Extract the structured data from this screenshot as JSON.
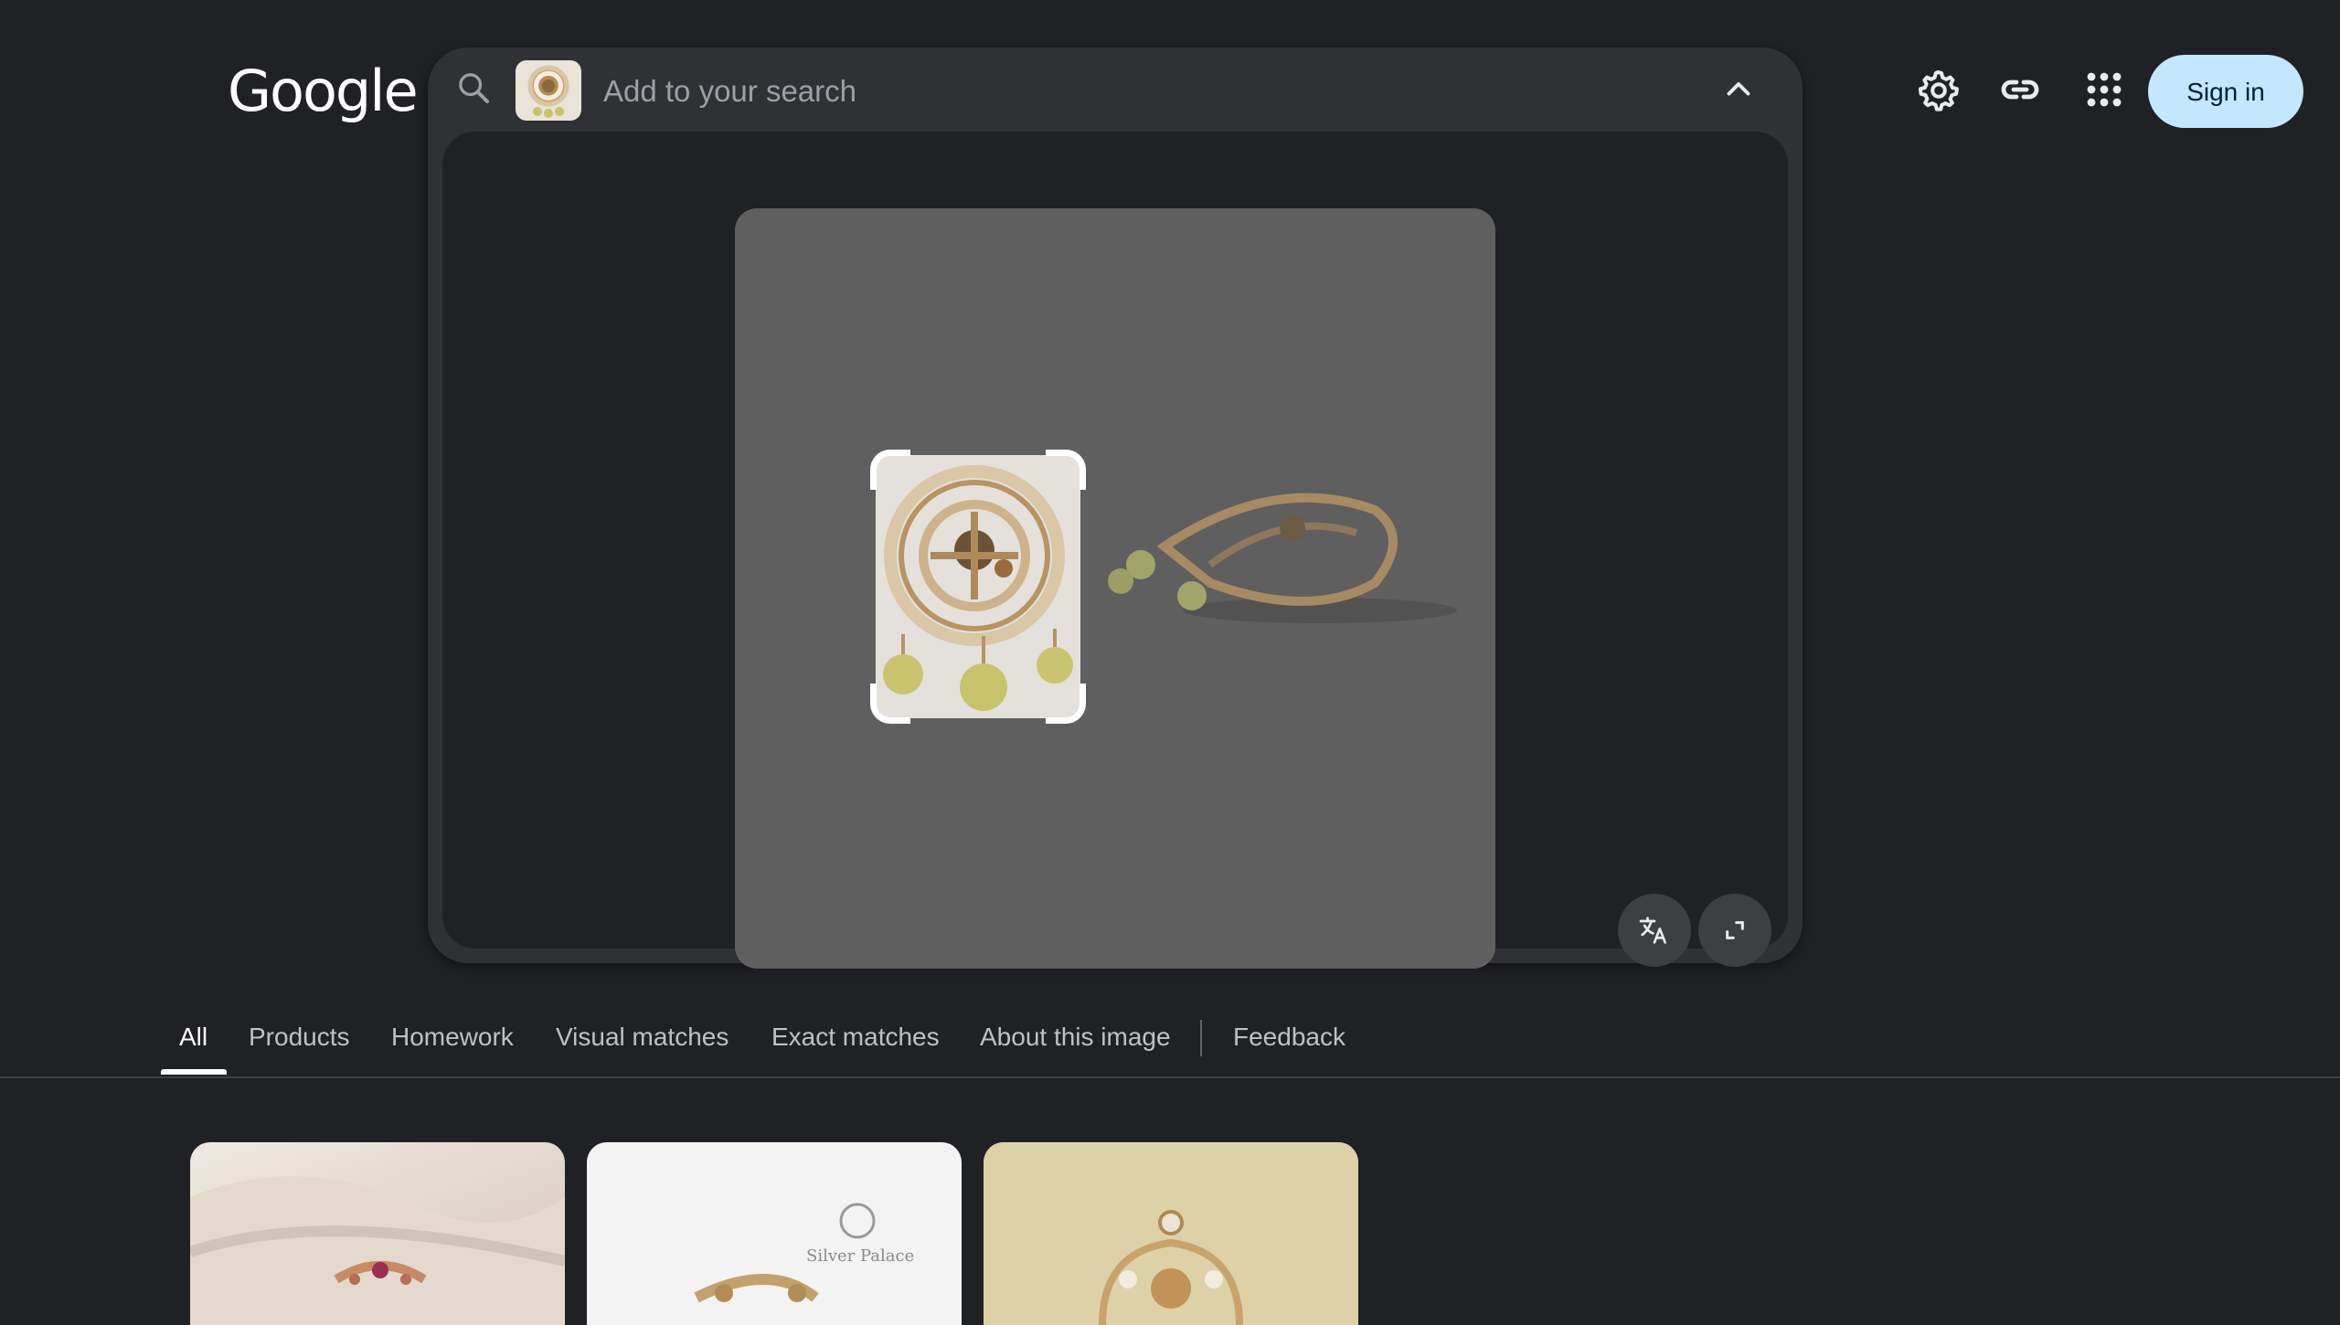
{
  "header": {
    "logo": "Google",
    "sign_in_label": "Sign in",
    "icons": [
      "settings-icon",
      "link-icon",
      "apps-icon"
    ]
  },
  "search": {
    "placeholder": "Add to your search",
    "icons": [
      "search-icon",
      "chevron-up-icon"
    ]
  },
  "viewer": {
    "buttons": [
      "translate-icon",
      "fullscreen-icon"
    ]
  },
  "tabs": {
    "items": [
      {
        "label": "All",
        "active": true
      },
      {
        "label": "Products"
      },
      {
        "label": "Homework"
      },
      {
        "label": "Visual matches"
      },
      {
        "label": "Exact matches"
      },
      {
        "label": "About this image"
      },
      {
        "label": "Feedback"
      }
    ]
  },
  "results": {
    "card_2_watermark": "Silver Palace"
  },
  "colors": {
    "background": "#202124",
    "panel": "#303134",
    "sign_in_bg": "#c2e7ff",
    "active_tab": "#ffffff"
  }
}
